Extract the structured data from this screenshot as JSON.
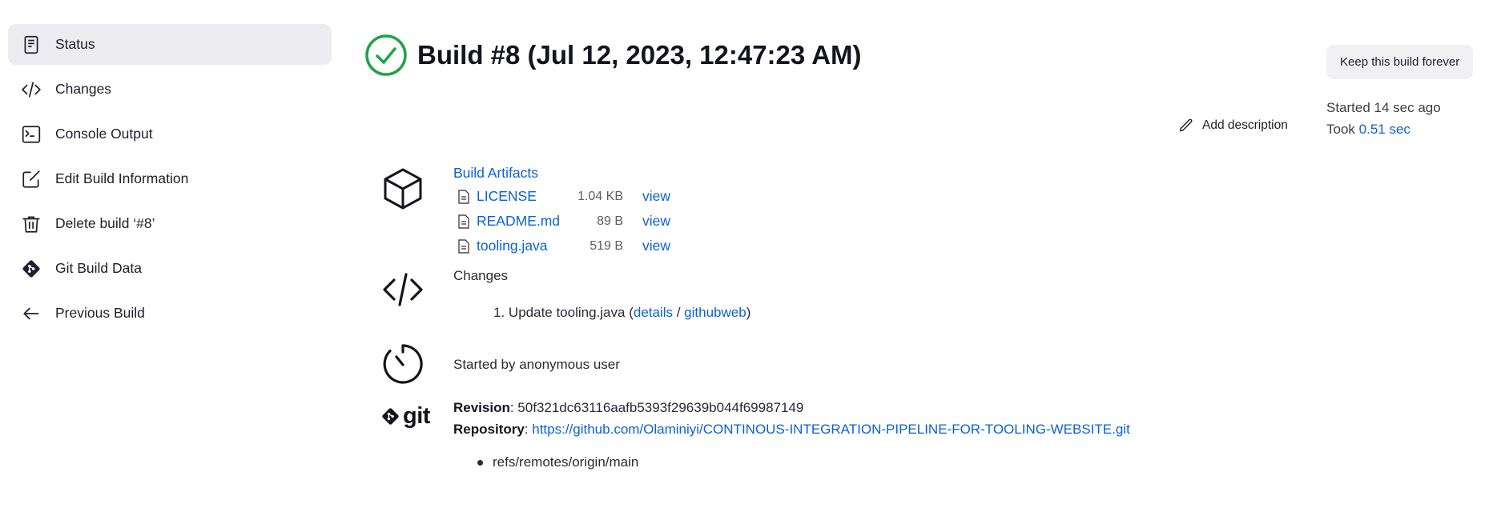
{
  "sidebar": {
    "items": [
      {
        "label": "Status",
        "icon": "document-icon",
        "active": true
      },
      {
        "label": "Changes",
        "icon": "code-icon"
      },
      {
        "label": "Console Output",
        "icon": "terminal-icon"
      },
      {
        "label": "Edit Build Information",
        "icon": "edit-icon"
      },
      {
        "label": "Delete build ‘#8’",
        "icon": "trash-icon"
      },
      {
        "label": "Git Build Data",
        "icon": "git-icon"
      },
      {
        "label": "Previous Build",
        "icon": "arrow-left-icon"
      }
    ]
  },
  "header": {
    "title": "Build #8 (Jul 12, 2023, 12:47:23 AM)",
    "status_icon": "success-check-icon",
    "status_color": "#1ea446",
    "keep_button": "Keep this build forever",
    "add_description": "Add description",
    "started_label": "Started 14 sec ago",
    "took_label": "Took",
    "took_value": "0.51 sec"
  },
  "artifacts": {
    "heading": "Build Artifacts",
    "files": [
      {
        "name": "LICENSE",
        "size": "1.04 KB",
        "action": "view"
      },
      {
        "name": "README.md",
        "size": "89 B",
        "action": "view"
      },
      {
        "name": "tooling.java",
        "size": "519 B",
        "action": "view"
      }
    ]
  },
  "changes": {
    "heading": "Changes",
    "number": "1.",
    "item_text": "Update tooling.java (",
    "details_link": "details",
    "separator": " / ",
    "githubweb_link": "githubweb",
    "close": ")"
  },
  "cause": {
    "text": "Started by anonymous user"
  },
  "git": {
    "logo_text": "git",
    "revision_label": "Revision",
    "revision_value": ": 50f321dc63116aafb5393f29639b044f69987149",
    "repository_label": "Repository",
    "repository_sep": ": ",
    "repository_url": "https://github.com/Olaminiyi/CONTINOUS-INTEGRATION-PIPELINE-FOR-TOOLING-WEBSITE.git",
    "branch": "refs/remotes/origin/main"
  },
  "colors": {
    "link": "#0b61d6",
    "success": "#1ea446",
    "active_bg": "#ececf1"
  }
}
